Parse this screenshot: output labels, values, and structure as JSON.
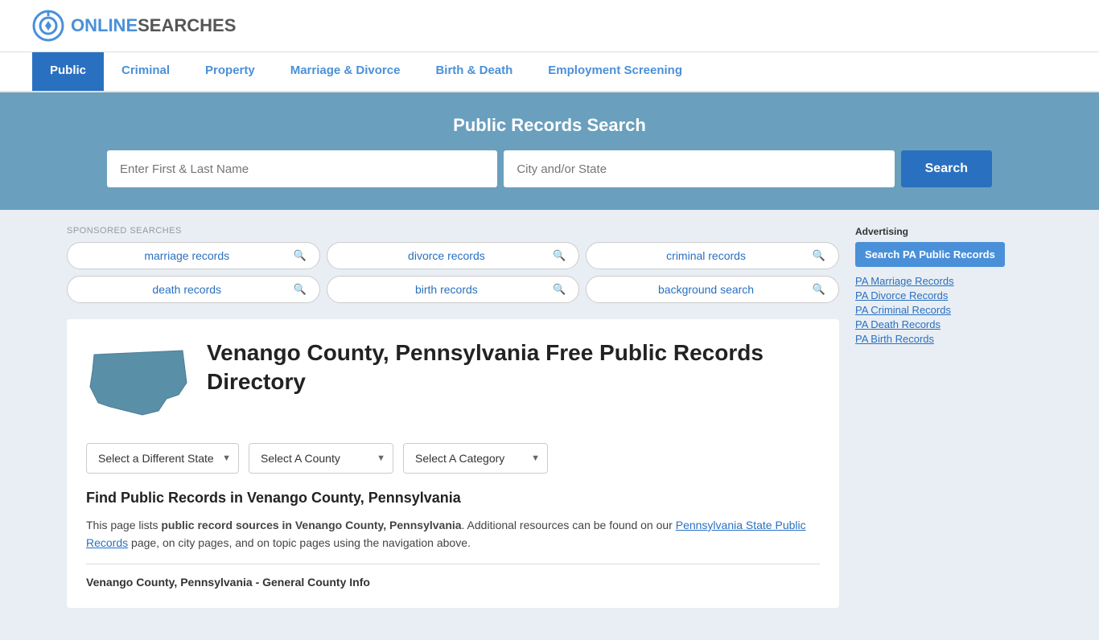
{
  "header": {
    "logo_text_online": "ONLINE",
    "logo_text_searches": "SEARCHES"
  },
  "nav": {
    "items": [
      {
        "label": "Public",
        "active": true
      },
      {
        "label": "Criminal",
        "active": false
      },
      {
        "label": "Property",
        "active": false
      },
      {
        "label": "Marriage & Divorce",
        "active": false
      },
      {
        "label": "Birth & Death",
        "active": false
      },
      {
        "label": "Employment Screening",
        "active": false
      }
    ]
  },
  "search_banner": {
    "title": "Public Records Search",
    "name_placeholder": "Enter First & Last Name",
    "location_placeholder": "City and/or State",
    "button_label": "Search"
  },
  "sponsored": {
    "label": "SPONSORED SEARCHES",
    "items": [
      {
        "text": "marriage records"
      },
      {
        "text": "divorce records"
      },
      {
        "text": "criminal records"
      },
      {
        "text": "death records"
      },
      {
        "text": "birth records"
      },
      {
        "text": "background search"
      }
    ]
  },
  "directory": {
    "title": "Venango County, Pennsylvania Free Public Records Directory",
    "dropdowns": {
      "state_label": "Select a Different State",
      "county_label": "Select A County",
      "category_label": "Select A Category"
    },
    "find_records_title": "Find Public Records in Venango County, Pennsylvania",
    "find_records_text_1": "This page lists ",
    "find_records_bold": "public record sources in Venango County, Pennsylvania",
    "find_records_text_2": ". Additional resources can be found on our ",
    "find_records_link": "Pennsylvania State Public Records",
    "find_records_text_3": " page, on city pages, and on topic pages using the navigation above.",
    "county_info_label": "Venango County, Pennsylvania - General County Info"
  },
  "sidebar": {
    "ad_label": "Advertising",
    "ad_button": "Search PA Public Records",
    "links": [
      {
        "text": "PA Marriage Records"
      },
      {
        "text": "PA Divorce Records"
      },
      {
        "text": "PA Criminal Records"
      },
      {
        "text": "PA Death Records"
      },
      {
        "text": "PA Birth Records"
      }
    ]
  }
}
